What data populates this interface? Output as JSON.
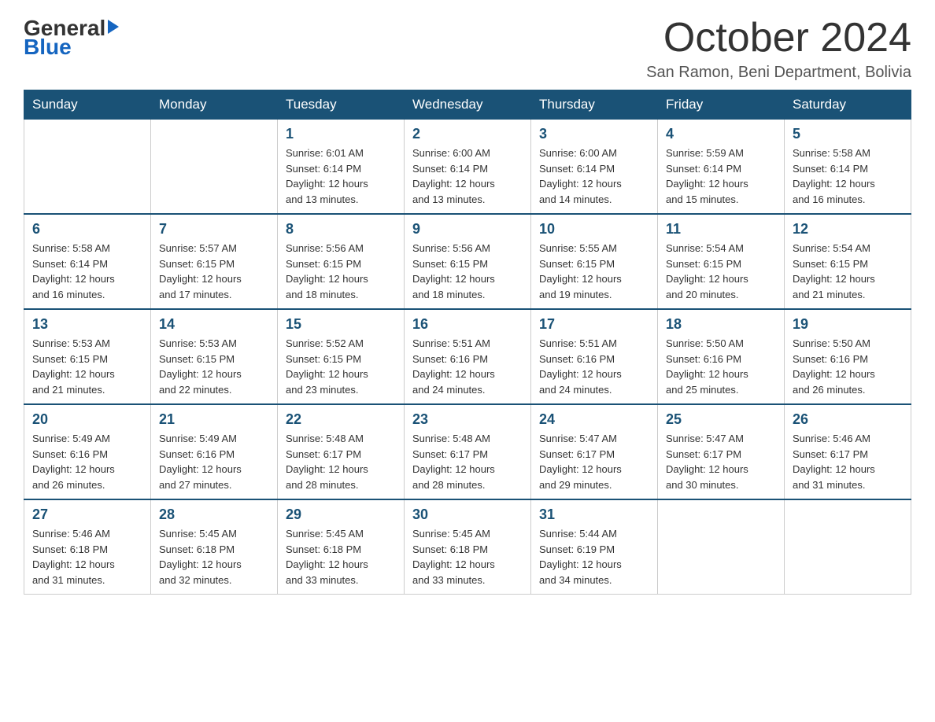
{
  "logo": {
    "general": "General",
    "blue": "Blue"
  },
  "title": {
    "month_year": "October 2024",
    "location": "San Ramon, Beni Department, Bolivia"
  },
  "headers": [
    "Sunday",
    "Monday",
    "Tuesday",
    "Wednesday",
    "Thursday",
    "Friday",
    "Saturday"
  ],
  "weeks": [
    [
      {
        "day": "",
        "info": ""
      },
      {
        "day": "",
        "info": ""
      },
      {
        "day": "1",
        "info": "Sunrise: 6:01 AM\nSunset: 6:14 PM\nDaylight: 12 hours\nand 13 minutes."
      },
      {
        "day": "2",
        "info": "Sunrise: 6:00 AM\nSunset: 6:14 PM\nDaylight: 12 hours\nand 13 minutes."
      },
      {
        "day": "3",
        "info": "Sunrise: 6:00 AM\nSunset: 6:14 PM\nDaylight: 12 hours\nand 14 minutes."
      },
      {
        "day": "4",
        "info": "Sunrise: 5:59 AM\nSunset: 6:14 PM\nDaylight: 12 hours\nand 15 minutes."
      },
      {
        "day": "5",
        "info": "Sunrise: 5:58 AM\nSunset: 6:14 PM\nDaylight: 12 hours\nand 16 minutes."
      }
    ],
    [
      {
        "day": "6",
        "info": "Sunrise: 5:58 AM\nSunset: 6:14 PM\nDaylight: 12 hours\nand 16 minutes."
      },
      {
        "day": "7",
        "info": "Sunrise: 5:57 AM\nSunset: 6:15 PM\nDaylight: 12 hours\nand 17 minutes."
      },
      {
        "day": "8",
        "info": "Sunrise: 5:56 AM\nSunset: 6:15 PM\nDaylight: 12 hours\nand 18 minutes."
      },
      {
        "day": "9",
        "info": "Sunrise: 5:56 AM\nSunset: 6:15 PM\nDaylight: 12 hours\nand 18 minutes."
      },
      {
        "day": "10",
        "info": "Sunrise: 5:55 AM\nSunset: 6:15 PM\nDaylight: 12 hours\nand 19 minutes."
      },
      {
        "day": "11",
        "info": "Sunrise: 5:54 AM\nSunset: 6:15 PM\nDaylight: 12 hours\nand 20 minutes."
      },
      {
        "day": "12",
        "info": "Sunrise: 5:54 AM\nSunset: 6:15 PM\nDaylight: 12 hours\nand 21 minutes."
      }
    ],
    [
      {
        "day": "13",
        "info": "Sunrise: 5:53 AM\nSunset: 6:15 PM\nDaylight: 12 hours\nand 21 minutes."
      },
      {
        "day": "14",
        "info": "Sunrise: 5:53 AM\nSunset: 6:15 PM\nDaylight: 12 hours\nand 22 minutes."
      },
      {
        "day": "15",
        "info": "Sunrise: 5:52 AM\nSunset: 6:15 PM\nDaylight: 12 hours\nand 23 minutes."
      },
      {
        "day": "16",
        "info": "Sunrise: 5:51 AM\nSunset: 6:16 PM\nDaylight: 12 hours\nand 24 minutes."
      },
      {
        "day": "17",
        "info": "Sunrise: 5:51 AM\nSunset: 6:16 PM\nDaylight: 12 hours\nand 24 minutes."
      },
      {
        "day": "18",
        "info": "Sunrise: 5:50 AM\nSunset: 6:16 PM\nDaylight: 12 hours\nand 25 minutes."
      },
      {
        "day": "19",
        "info": "Sunrise: 5:50 AM\nSunset: 6:16 PM\nDaylight: 12 hours\nand 26 minutes."
      }
    ],
    [
      {
        "day": "20",
        "info": "Sunrise: 5:49 AM\nSunset: 6:16 PM\nDaylight: 12 hours\nand 26 minutes."
      },
      {
        "day": "21",
        "info": "Sunrise: 5:49 AM\nSunset: 6:16 PM\nDaylight: 12 hours\nand 27 minutes."
      },
      {
        "day": "22",
        "info": "Sunrise: 5:48 AM\nSunset: 6:17 PM\nDaylight: 12 hours\nand 28 minutes."
      },
      {
        "day": "23",
        "info": "Sunrise: 5:48 AM\nSunset: 6:17 PM\nDaylight: 12 hours\nand 28 minutes."
      },
      {
        "day": "24",
        "info": "Sunrise: 5:47 AM\nSunset: 6:17 PM\nDaylight: 12 hours\nand 29 minutes."
      },
      {
        "day": "25",
        "info": "Sunrise: 5:47 AM\nSunset: 6:17 PM\nDaylight: 12 hours\nand 30 minutes."
      },
      {
        "day": "26",
        "info": "Sunrise: 5:46 AM\nSunset: 6:17 PM\nDaylight: 12 hours\nand 31 minutes."
      }
    ],
    [
      {
        "day": "27",
        "info": "Sunrise: 5:46 AM\nSunset: 6:18 PM\nDaylight: 12 hours\nand 31 minutes."
      },
      {
        "day": "28",
        "info": "Sunrise: 5:45 AM\nSunset: 6:18 PM\nDaylight: 12 hours\nand 32 minutes."
      },
      {
        "day": "29",
        "info": "Sunrise: 5:45 AM\nSunset: 6:18 PM\nDaylight: 12 hours\nand 33 minutes."
      },
      {
        "day": "30",
        "info": "Sunrise: 5:45 AM\nSunset: 6:18 PM\nDaylight: 12 hours\nand 33 minutes."
      },
      {
        "day": "31",
        "info": "Sunrise: 5:44 AM\nSunset: 6:19 PM\nDaylight: 12 hours\nand 34 minutes."
      },
      {
        "day": "",
        "info": ""
      },
      {
        "day": "",
        "info": ""
      }
    ]
  ]
}
